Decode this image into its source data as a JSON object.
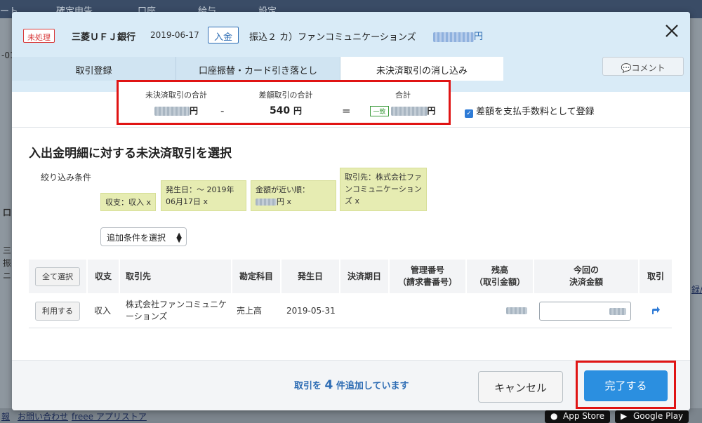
{
  "background": {
    "nav": [
      "ート",
      "確定申告",
      "口座",
      "給与",
      "設定"
    ],
    "side_texts": [
      "-01",
      "口",
      "三",
      "振",
      "ニ",
      "録/"
    ],
    "footer_links": [
      "報",
      "お問い合わせ",
      "freee アプリストア"
    ],
    "stores": [
      "App Store",
      "Google Play"
    ]
  },
  "modal": {
    "status": "未処理",
    "bank": "三菱ＵＦＪ銀行",
    "date": "2019-06-17",
    "type": "入金",
    "description": "振込２ カ）ファンコミュニケーションズ",
    "amount_unit": "円",
    "tabs": [
      "取引登録",
      "口座振替・カード引き落とし",
      "未決済取引の消し込み"
    ],
    "active_tab": 2,
    "comment": "コメント",
    "summary": {
      "unsettled_label": "未決済取引の合計",
      "unsettled_unit": "円",
      "diff_label": "差額取引の合計",
      "diff_value": "540",
      "diff_unit": "円",
      "total_label": "合計",
      "total_badge": "一致",
      "total_unit": "円",
      "minus": "-",
      "equals": "="
    },
    "fee_checkbox": {
      "label": "差額を支払手数料として登録",
      "checked": true
    },
    "section_title": "入出金明細に対する未決済取引を選択",
    "filter_label": "絞り込み条件",
    "filters": [
      "収支：収入 x",
      "発生日：〜 2019年06月17日 x",
      "金額が近い順：",
      "円 x",
      "取引先：株式会社ファンコミュニケーションズ x"
    ],
    "add_condition": "追加条件を選択",
    "table": {
      "select_all": "全て選択",
      "headers": [
        "収支",
        "取引先",
        "勘定科目",
        "発生日",
        "決済期日",
        "管理番号\n（請求書番号）",
        "残高\n（取引金額）",
        "今回の\n決済金額",
        "取引"
      ],
      "rows": [
        {
          "button": "利用する",
          "type": "収入",
          "partner": "株式会社ファンコミュニケーションズ",
          "account": "売上高",
          "date": "2019-05-31",
          "due": "",
          "number": ""
        }
      ]
    },
    "footer": {
      "added_prefix": "取引を ",
      "added_count": "4",
      "added_suffix": " 件追加しています",
      "cancel": "キャンセル",
      "done": "完了する"
    }
  },
  "colors": {
    "accent": "#2b8fe0",
    "highlight": "#e01414",
    "header_bg": "#d9ebf7",
    "chip_bg": "#e6ecb2"
  }
}
